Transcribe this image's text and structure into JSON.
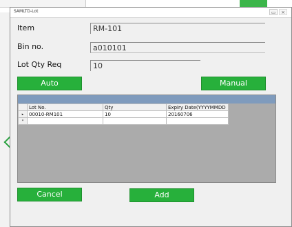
{
  "window": {
    "title": "SAMLTD-Lot",
    "controls": {
      "minimize": "▭",
      "close": "⨯"
    }
  },
  "form": {
    "item_label": "Item",
    "item_value": "RM-101",
    "bin_label": "Bin no.",
    "bin_value": "a010101",
    "lotqty_label": "Lot Qty Req",
    "lotqty_value": "10"
  },
  "buttons": {
    "auto": "Auto",
    "manual": "Manual",
    "cancel": "Cancel",
    "add": "Add"
  },
  "grid": {
    "columns": [
      "Lot No.",
      "Qty",
      "Expiry Date(YYYYMMDD"
    ],
    "rows": [
      {
        "marker": "▸",
        "lot": "00010-RM101",
        "qty": "10",
        "expiry": "20160706"
      }
    ],
    "new_row_marker": "*"
  },
  "colors": {
    "button_green": "#27b03b",
    "grid_header_blue": "#7f9bbd",
    "grid_background": "#ababab",
    "window_bg": "#f0f0f0"
  }
}
